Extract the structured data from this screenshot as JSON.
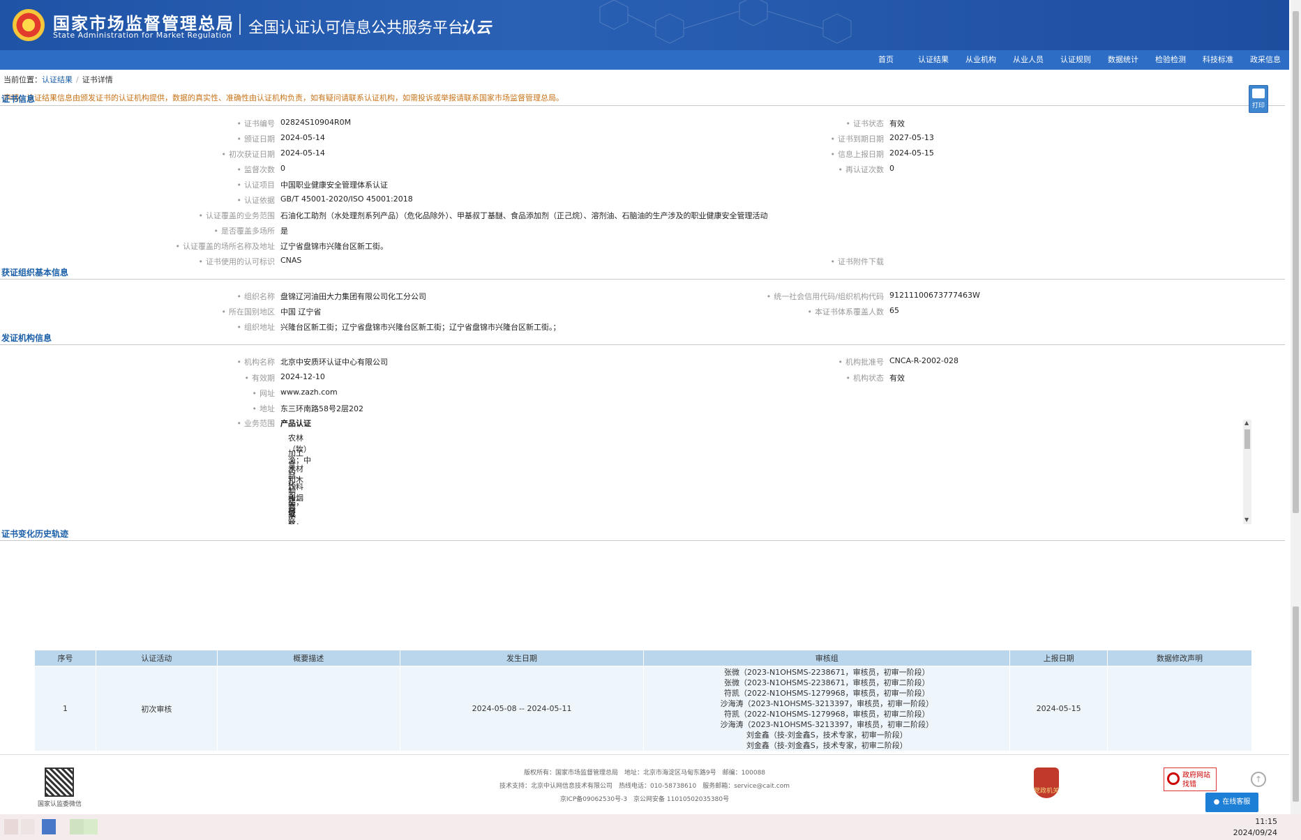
{
  "header": {
    "org_cn": "国家市场监督管理总局",
    "org_en": "State Administration for Market Regulation",
    "platform": "全国认证认可信息公共服务平台",
    "platform_logo": "认云"
  },
  "nav": [
    "首页",
    "认证结果",
    "从业机构",
    "从业人员",
    "认证规则",
    "数据统计",
    "检验检测",
    "科技标准",
    "政采信息"
  ],
  "breadcrumb": {
    "prefix": "当前位置：",
    "link": "认证结果",
    "sep": "/",
    "current": "证书详情"
  },
  "notice": "声明：认证结果信息由颁发证书的认证机构提供，数据的真实性、准确性由认证机构负责，如有疑问请联系认证机构，如需投诉或举报请联系国家市场监督管理总局。",
  "print_label": "打印",
  "cert_section": {
    "title": "证书信息",
    "left": [
      {
        "label": "证书编号",
        "value": "02824S10904R0M"
      },
      {
        "label": "颁证日期",
        "value": "2024-05-14"
      },
      {
        "label": "初次获证日期",
        "value": "2024-05-14"
      },
      {
        "label": "监督次数",
        "value": "0"
      },
      {
        "label": "认证项目",
        "value": "中国职业健康安全管理体系认证"
      },
      {
        "label": "认证依据",
        "value": "GB/T 45001-2020/ISO 45001:2018"
      },
      {
        "label": "认证覆盖的业务范围",
        "value": "石油化工助剂（水处理剂系列产品）（危化品除外）、甲基叔丁基醚、食品添加剂（正己烷）、溶剂油、石脑油的生产涉及的职业健康安全管理活动"
      },
      {
        "label": "是否覆盖多场所",
        "value": "是"
      },
      {
        "label": "认证覆盖的场所名称及地址",
        "value": "辽宁省盘锦市兴隆台区新工街。"
      },
      {
        "label": "证书使用的认可标识",
        "value": "CNAS"
      }
    ],
    "right": [
      {
        "label": "证书状态",
        "value": "有效"
      },
      {
        "label": "证书到期日期",
        "value": "2027-05-13"
      },
      {
        "label": "信息上报日期",
        "value": "2024-05-15"
      },
      {
        "label": "再认证次数",
        "value": "0"
      },
      {
        "label": "证书附件下载",
        "value": ""
      }
    ]
  },
  "org_section": {
    "title": "获证组织基本信息",
    "left": [
      {
        "label": "组织名称",
        "value": "盘锦辽河油田大力集团有限公司化工分公司"
      },
      {
        "label": "所在国别地区",
        "value": "中国 辽宁省"
      },
      {
        "label": "组织地址",
        "value": "兴隆台区新工街；辽宁省盘锦市兴隆台区新工街；辽宁省盘锦市兴隆台区新工街。；"
      }
    ],
    "right": [
      {
        "label": "统一社会信用代码/组织机构代码",
        "value": "91211100673777463W"
      },
      {
        "label": "本证书体系覆盖人数",
        "value": "65"
      }
    ]
  },
  "body_section": {
    "title": "发证机构信息",
    "left": [
      {
        "label": "机构名称",
        "value": "北京中安质环认证中心有限公司"
      },
      {
        "label": "有效期",
        "value": "2024-12-10"
      },
      {
        "label": "网址",
        "value": "www.zazh.com"
      },
      {
        "label": "地址",
        "value": "东三环南路58号2层202"
      },
      {
        "label": "业务范围",
        "value": "产品认证"
      }
    ],
    "right": [
      {
        "label": "机构批准号",
        "value": "CNCA-R-2002-028"
      },
      {
        "label": "机构状态",
        "value": "有效"
      }
    ],
    "scope_items": [
      "农林（牧）渔；中药",
      "加工食品、饮料和烟草",
      "木材和木制品；纸浆、纸和纸制品，印刷品",
      "化工类产品",
      "建材产品",
      "家具；其他未分类产品",
      "金属材料及金属制品"
    ]
  },
  "history_section": {
    "title": "证书变化历史轨迹",
    "columns": [
      "序号",
      "认证活动",
      "概要描述",
      "发生日期",
      "审核组",
      "上报日期",
      "数据修改声明"
    ],
    "rows": [
      {
        "no": "1",
        "activity": "初次审核",
        "summary": "",
        "date": "2024-05-08 -- 2024-05-11",
        "auditors": [
          "张微（2023-N1OHSMS-2238671，审核员，初审一阶段）",
          "张微（2023-N1OHSMS-2238671，审核员，初审二阶段）",
          "符凯（2022-N1OHSMS-1279968，审核员，初审一阶段）",
          "沙海涛（2023-N1OHSMS-3213397，审核员，初审一阶段）",
          "符凯（2022-N1OHSMS-1279968，审核员，初审二阶段）",
          "沙海涛（2023-N1OHSMS-3213397，审核员，初审二阶段）",
          "刘金鑫（技-刘金鑫S，技术专家，初审一阶段）",
          "刘金鑫（技-刘金鑫S，技术专家，初审二阶段）"
        ],
        "report_date": "2024-05-15",
        "statement": ""
      }
    ]
  },
  "footer": {
    "qr_label": "国家认监委微信",
    "line1": "版权所有：国家市场监督管理总局　地址：北京市海淀区马甸东路9号　邮编：100088",
    "line2": "技术支持：北京中认网信息技术有限公司　热线电话：010-58738610　服务邮箱：service@cait.com",
    "line3": "京ICP备09062530号-3　京公网安备 11010502035380号",
    "badge": "党政机关",
    "gov_err_1": "政府网站",
    "gov_err_2": "找错",
    "service": "在线客服"
  },
  "taskbar": {
    "time": "11:15",
    "date": "2024/09/24"
  }
}
